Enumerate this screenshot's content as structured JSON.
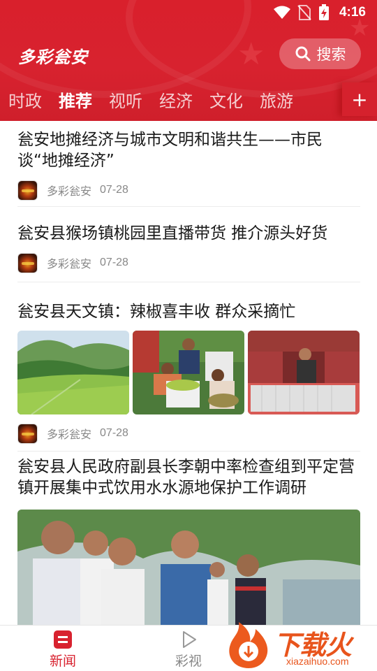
{
  "status_bar": {
    "time": "4:16"
  },
  "header": {
    "app_title": "多彩瓮安",
    "search_label": "搜索",
    "brand_color": "#d8222f"
  },
  "tabs": [
    {
      "label": "时政",
      "active": false
    },
    {
      "label": "推荐",
      "active": true
    },
    {
      "label": "视听",
      "active": false
    },
    {
      "label": "经济",
      "active": false
    },
    {
      "label": "文化",
      "active": false
    },
    {
      "label": "旅游",
      "active": false
    }
  ],
  "tab_add_label": "+",
  "articles": [
    {
      "title": "瓮安地摊经济与城市文明和谐共生——市民谈“地摊经济”",
      "source": "多彩瓮安",
      "date": "07-28"
    },
    {
      "title": "瓮安县猴场镇桃园里直播带货 推介源头好货",
      "source": "多彩瓮安",
      "date": "07-28"
    },
    {
      "title": "瓮安县天文镇：辣椒喜丰收 群众采摘忙",
      "source": "多彩瓮安",
      "date": "07-28"
    },
    {
      "title": "瓮安县人民政府副县长李朝中率检查组到平定营镇开展集中式饮用水水源地保护工作调研"
    }
  ],
  "bottom_nav": [
    {
      "label": "新闻",
      "icon": "news-icon",
      "active": true
    },
    {
      "label": "彩视",
      "icon": "play-icon",
      "active": false
    }
  ],
  "watermark": {
    "text": "下载火",
    "sub": "xiazaihuo.com"
  }
}
